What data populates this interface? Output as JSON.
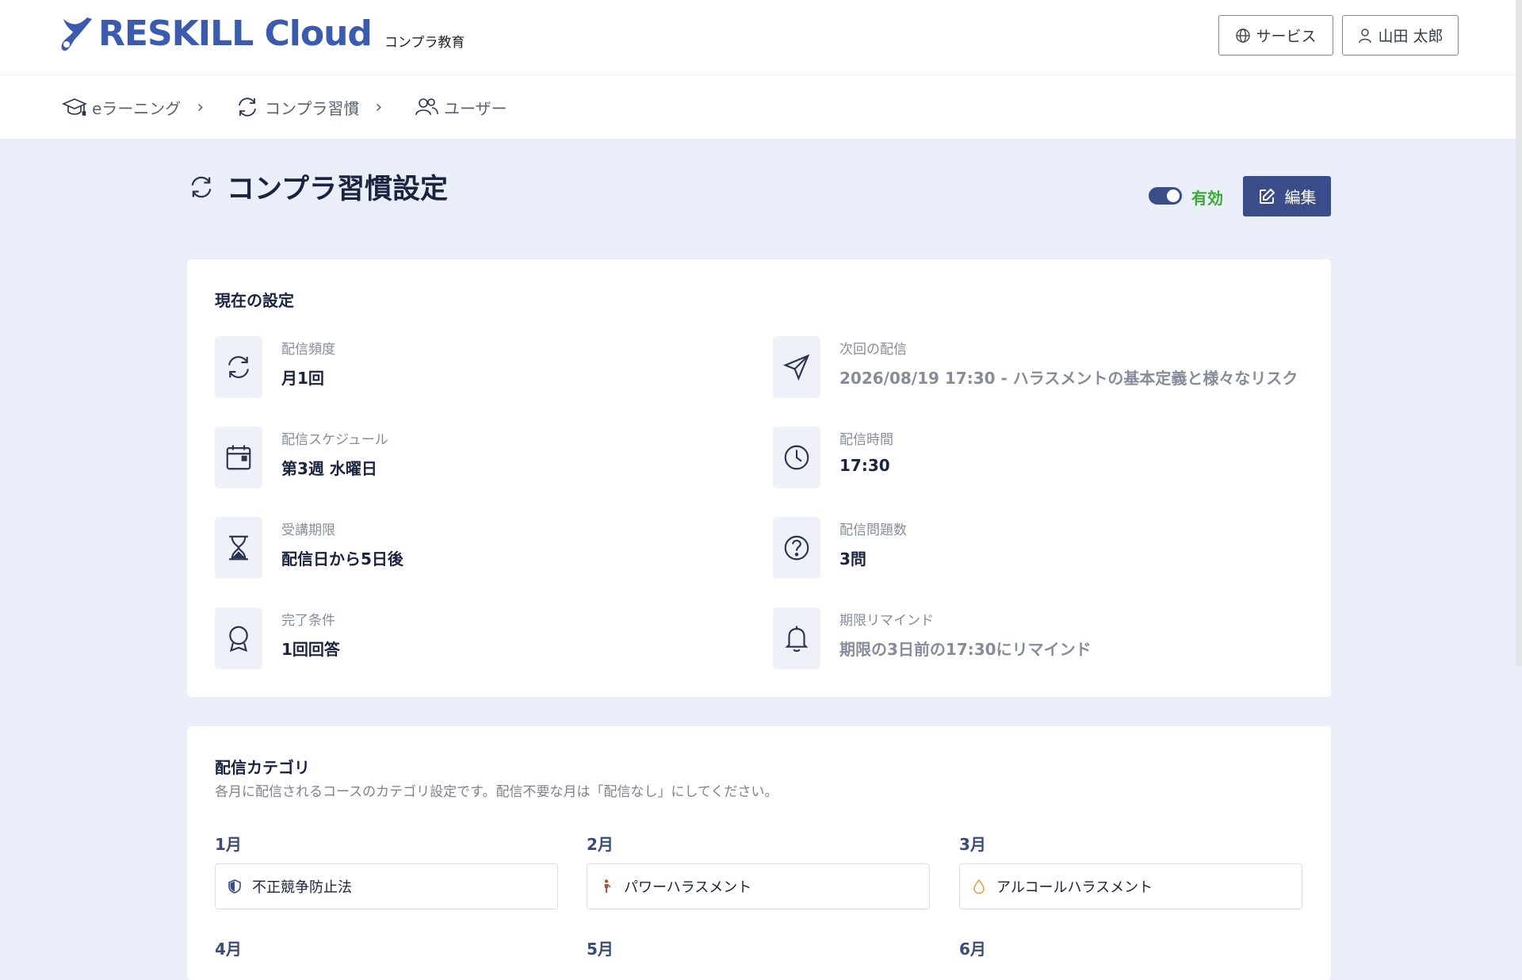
{
  "header": {
    "brand": "RESKILL Cloud",
    "brand_sub": "コンプラ教育",
    "service_label": "サービス",
    "user_label": "山田 太郎"
  },
  "breadcrumb": [
    {
      "label": "eラーニング",
      "icon": "graduation-cap-icon"
    },
    {
      "label": "コンプラ習慣",
      "icon": "refresh-icon"
    },
    {
      "label": "ユーザー",
      "icon": "users-icon"
    }
  ],
  "page": {
    "title": "コンプラ習慣設定",
    "status_label": "有効",
    "edit_label": "編集",
    "enabled": true
  },
  "current_settings": {
    "title": "現在の設定",
    "items": [
      {
        "label": "配信頻度",
        "value": "月1回",
        "icon": "refresh-icon"
      },
      {
        "label": "次回の配信",
        "value": "2026/08/19 17:30 - ハラスメントの基本定義と様々なリスク",
        "icon": "send-icon"
      },
      {
        "label": "配信スケジュール",
        "value": "第3週 水曜日",
        "icon": "calendar-icon"
      },
      {
        "label": "配信時間",
        "value": "17:30",
        "icon": "clock-icon"
      },
      {
        "label": "受講期限",
        "value": "配信日から5日後",
        "icon": "hourglass-icon"
      },
      {
        "label": "配信問題数",
        "value": "3問",
        "icon": "question-icon"
      },
      {
        "label": "完了条件",
        "value": "1回回答",
        "icon": "award-icon"
      },
      {
        "label": "期限リマインド",
        "value": "期限の3日前の17:30にリマインド",
        "icon": "bell-icon"
      }
    ]
  },
  "categories": {
    "title": "配信カテゴリ",
    "description": "各月に配信されるコースのカテゴリ設定です。配信不要な月は「配信なし」にしてください。",
    "months": [
      {
        "month": "1月",
        "category": "不正競争防止法",
        "icon": "shield-icon",
        "color": "#3a4c8a"
      },
      {
        "month": "2月",
        "category": "パワーハラスメント",
        "icon": "person-icon",
        "color": "#b0533a"
      },
      {
        "month": "3月",
        "category": "アルコールハラスメント",
        "icon": "drop-icon",
        "color": "#e0a040"
      },
      {
        "month": "4月"
      },
      {
        "month": "5月"
      },
      {
        "month": "6月"
      }
    ]
  },
  "colors": {
    "accent": "#3a4c8a",
    "status_green": "#3aaa35",
    "background": "#ebeff9"
  }
}
